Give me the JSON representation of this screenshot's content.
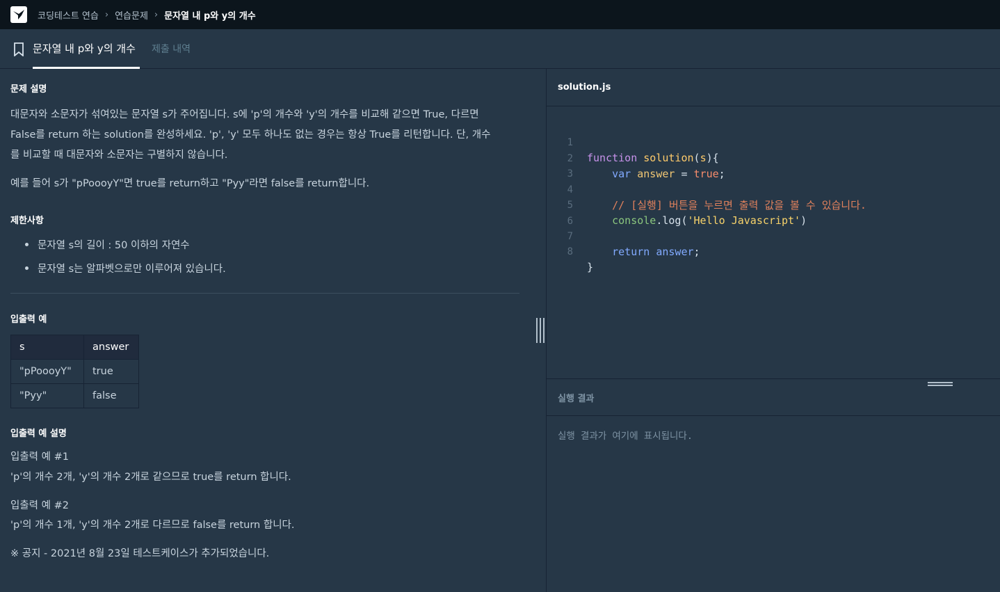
{
  "breadcrumb": {
    "items": [
      "코딩테스트 연습",
      "연습문제",
      "문자열 내 p와 y의 개수"
    ]
  },
  "tabs": {
    "title": "문자열 내 p와 y의 개수",
    "history": "제출 내역"
  },
  "problem": {
    "description_heading": "문제 설명",
    "description_lines": [
      "대문자와 소문자가 섞여있는 문자열 s가 주어집니다. s에 'p'의 개수와 'y'의 개수를 비교해 같으면 True, 다르면",
      "False를 return 하는 solution를 완성하세요. 'p', 'y' 모두 하나도 없는 경우는 항상 True를 리턴합니다. 단, 개수",
      "를 비교할 때 대문자와 소문자는 구별하지 않습니다."
    ],
    "example_text": "예를 들어 s가 \"pPoooyY\"면 true를 return하고 \"Pyy\"라면 false를 return합니다.",
    "constraints_heading": "제한사항",
    "constraints": [
      "문자열 s의 길이 : 50 이하의 자연수",
      "문자열 s는 알파벳으로만 이루어져 있습니다."
    ],
    "io_heading": "입출력 예",
    "io_table": {
      "headers": [
        "s",
        "answer"
      ],
      "rows": [
        [
          "\"pPoooyY\"",
          "true"
        ],
        [
          "\"Pyy\"",
          "false"
        ]
      ]
    },
    "io_explain_heading": "입출력 예 설명",
    "examples": [
      {
        "title": "입출력 예 #1",
        "text": "'p'의 개수 2개, 'y'의 개수 2개로 같으므로 true를 return 합니다."
      },
      {
        "title": "입출력 예 #2",
        "text": "'p'의 개수 1개, 'y'의 개수 2개로 다르므로 false를 return 합니다."
      }
    ],
    "notice": "※ 공지 - 2021년 8월 23일 테스트케이스가 추가되었습니다."
  },
  "editor": {
    "file_name": "solution.js",
    "line_numbers": [
      "1",
      "2",
      "3",
      "4",
      "5",
      "6",
      "7",
      "8"
    ],
    "code": {
      "l1_kw": "function",
      "l1_fn": "solution",
      "l1_rest_a": "(",
      "l1_param": "s",
      "l1_rest_b": "){",
      "l2_kw": "var",
      "l2_var": "answer",
      "l2_eq": " = ",
      "l2_val": "true",
      "l2_end": ";",
      "l4_comment": "// [실행] 버튼을 누르면 출력 값을 볼 수 있습니다.",
      "l5_obj": "console",
      "l5_method": ".log(",
      "l5_str": "'Hello Javascript'",
      "l5_end": ")",
      "l7_kw": "return",
      "l7_var": "answer",
      "l7_end": ";",
      "l8": "}"
    }
  },
  "result": {
    "title": "실행 결과",
    "placeholder": "실행 결과가 여기에 표시됩니다."
  }
}
